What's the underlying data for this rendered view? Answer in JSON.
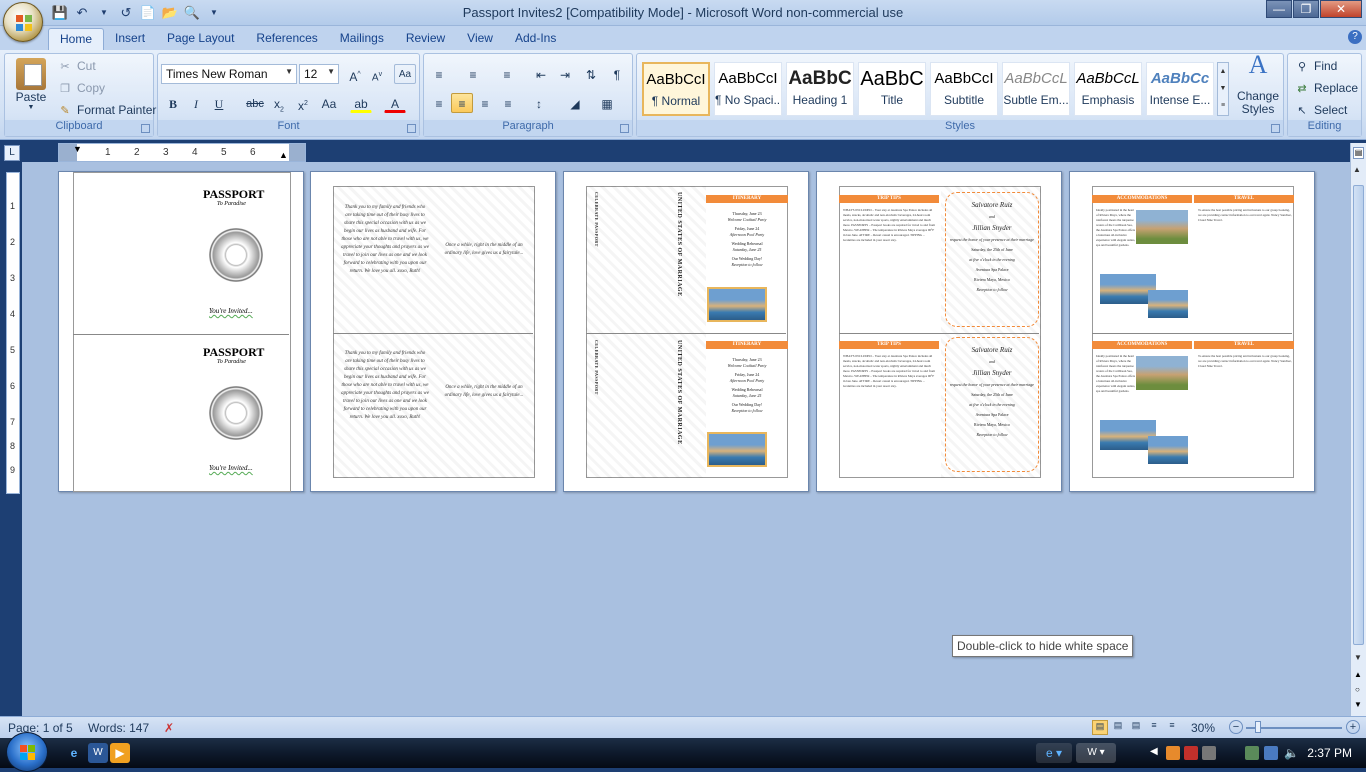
{
  "window": {
    "title": "Passport Invites2 [Compatibility Mode] - Microsoft Word non-commercial use"
  },
  "qat": {
    "save_icon": "save-icon",
    "undo_icon": "undo-icon",
    "redo_icon": "redo-icon"
  },
  "tabs": [
    "Home",
    "Insert",
    "Page Layout",
    "References",
    "Mailings",
    "Review",
    "View",
    "Add-Ins"
  ],
  "clipboard": {
    "paste": "Paste",
    "cut": "Cut",
    "copy": "Copy",
    "format_painter": "Format Painter",
    "label": "Clipboard"
  },
  "font": {
    "name": "Times New Roman",
    "size": "12",
    "label": "Font"
  },
  "paragraph": {
    "label": "Paragraph"
  },
  "styles": {
    "label": "Styles",
    "items": [
      {
        "preview": "AaBbCcI",
        "name": "¶ Normal"
      },
      {
        "preview": "AaBbCcI",
        "name": "¶ No Spaci..."
      },
      {
        "preview": "AaBbC",
        "name": "Heading 1"
      },
      {
        "preview": "AaBbC",
        "name": "Title"
      },
      {
        "preview": "AaBbCcI",
        "name": "Subtitle"
      },
      {
        "preview": "AaBbCcL",
        "name": "Subtle Em..."
      },
      {
        "preview": "AaBbCcL",
        "name": "Emphasis"
      },
      {
        "preview": "AaBbCc",
        "name": "Intense E..."
      }
    ],
    "change_styles": "Change Styles"
  },
  "editing": {
    "find": "Find",
    "replace": "Replace",
    "select": "Select",
    "label": "Editing"
  },
  "ruler": {
    "numbers": [
      "1",
      "2",
      "3",
      "4",
      "5",
      "6"
    ],
    "v_numbers": [
      "1",
      "2",
      "3",
      "4",
      "5",
      "6",
      "7",
      "8",
      "9"
    ]
  },
  "document": {
    "passport_title": "PASSPORT",
    "passport_sub": "To Paradise",
    "seal_text": "THE UNITED MARRIAGE OF ALEXANDRA & RUBEN",
    "invited": "You're Invited...",
    "thank_you": "Thank you to my family and friends who are taking time out of their busy lives to share this special occasion with us as we begin our lives as husband and wife. For those who are not able to travel with us, we appreciate your thoughts and prayers as we travel to join our lives as one and we look forward to celebrating with you upon our return. We love you all. xoxo, Ruth!",
    "quote": "Once a while, right in the middle of an ordinary life, love gives us a fairytale...",
    "itinerary_title": "ITINERARY",
    "itinerary": [
      "Thursday, June 23",
      "Welcome Cocktail Party",
      "Friday, June 24",
      "Afternoon Pool Party",
      "Wedding Rehearsal",
      "Saturday, June 25",
      "Our Wedding Day!",
      "Reception to follow"
    ],
    "trip_tips_title": "TRIP TIPS",
    "trip_tips": "WHAT'S INCLUDED – Your stay at Aventura Spa Palace includes all meals, snacks, alcoholic and non-alcoholic beverages, 24-hour room service, non-motorized water sports, nightly entertainment and much more. PASSPORTS – Passport books are required for travel to and from Mexico. WEATHER – The temperature in Riviera Maya averages 90°F in late June. ATTIRE – Resort casual is encouraged. TIPPING – Gratuities are included in your resort stay.",
    "couple_line1": "Salvatore Ruiz",
    "couple_and": "and",
    "couple_line2": "Jillian Snyder",
    "couple_details": "request the honor of your presence at their marriage",
    "wedding_date": "Saturday, the 25th of June",
    "wedding_time": "at five o'clock in the evening",
    "venue": "Aventura Spa Palace",
    "venue_loc": "Riviera Maya, Mexico",
    "reception": "Reception to follow",
    "accommodations_title": "ACCOMMODATIONS",
    "travel_title": "TRAVEL",
    "accommodations": "Ideally positioned in the heart of Riviera Maya, where the rainforest meets the turquoise waters of the Caribbean Sea, the Aventura Spa Palace offers a luxurious all-inclusive experience with elegant suites, spa and beautiful gardens.",
    "travel": "To ensure the best possible pricing and inclusions to our group booking, we are providing contact information to our travel agent. Nancy Sanchez, Cloud Nine Travel.",
    "side_vtext_1": "CELEBRATE PASSPORT",
    "side_vtext_2": "UNITED STATES OF MARRIAGE"
  },
  "tooltip": "Double-click to hide white space",
  "status": {
    "page": "Page: 1 of 5",
    "words": "Words: 147",
    "zoom": "30%"
  },
  "clock": "2:37 PM",
  "colors": {
    "accent": "#f28b3a",
    "ribbon": "#d2e1f4",
    "canvas": "#a9c0e0"
  }
}
